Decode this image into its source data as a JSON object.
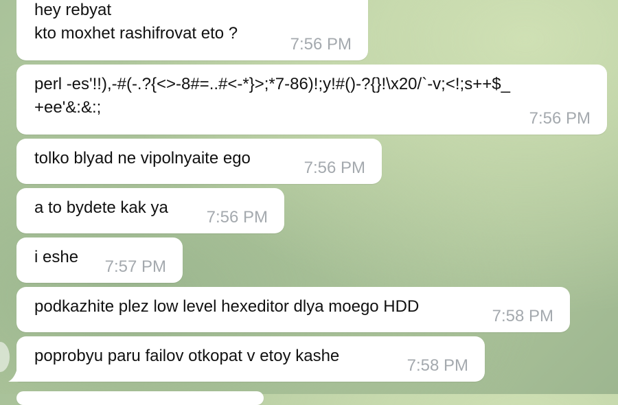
{
  "messages": [
    {
      "text": "hey rebyat\nkto moxhet rashifrovat eto ?",
      "time": "7:56 PM"
    },
    {
      "text": "perl -es'!!),-#(-.?{<>-8#=..#<-*}>;*7-86)!;y!#()-?{}!\\x20/`-v;<!;s++$_\n+ee'&:&:;",
      "time": "7:56 PM"
    },
    {
      "text": "tolko blyad ne vipolnyaite ego",
      "time": "7:56 PM"
    },
    {
      "text": "a to bydete kak ya",
      "time": "7:56 PM"
    },
    {
      "text": "i eshe",
      "time": "7:57 PM"
    },
    {
      "text": "podkazhite plez low level hexeditor dlya moego HDD",
      "time": "7:58 PM"
    },
    {
      "text": "poprobyu paru failov otkopat v etoy kashe",
      "time": "7:58 PM"
    }
  ]
}
